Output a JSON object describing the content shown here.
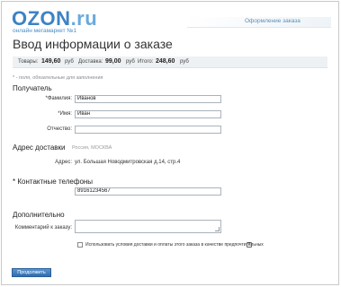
{
  "header": {
    "logo_text": "OZON",
    "logo_suffix": ".ru",
    "tagline": "онлайн мегамаркет №1",
    "top_link": "Оформление заказа"
  },
  "page": {
    "title": "Ввод информации о заказе"
  },
  "summary": {
    "goods_label": "Товары:",
    "goods_value": "149,60",
    "goods_unit": "руб",
    "delivery_label": "Доставка:",
    "delivery_value": "99,00",
    "delivery_unit": "руб",
    "total_label": "Итого:",
    "total_value": "248,60",
    "total_unit": "руб"
  },
  "required_note": "* - поля, обязательные для заполнения",
  "recipient": {
    "heading": "Получатель",
    "surname_label": "*Фамилия:",
    "surname_value": "Иванов",
    "name_label": "*Имя:",
    "name_value": "Иван",
    "patronymic_label": "Отчество:",
    "patronymic_value": ""
  },
  "address": {
    "heading": "Адрес доставки",
    "region": "Россия, МОСКВА",
    "label": "Адрес:",
    "value": "ул. Большая Новодмитровская д.14, стр.4"
  },
  "phones": {
    "heading": "* Контактные телефоны",
    "value": "89161234567"
  },
  "extra": {
    "heading": "Дополнительно",
    "comment_label": "Комментарий к заказу:",
    "comment_value": ""
  },
  "preferences": {
    "checkbox_label": "Использовать условия доставки и оплаты этого заказа в качестве предпочтительных",
    "checked": false
  },
  "actions": {
    "submit_label": "Продолжить"
  },
  "colors": {
    "brand": "#3d83c4",
    "button": "#3a78bb",
    "summary_bg": "#edf1f4"
  }
}
